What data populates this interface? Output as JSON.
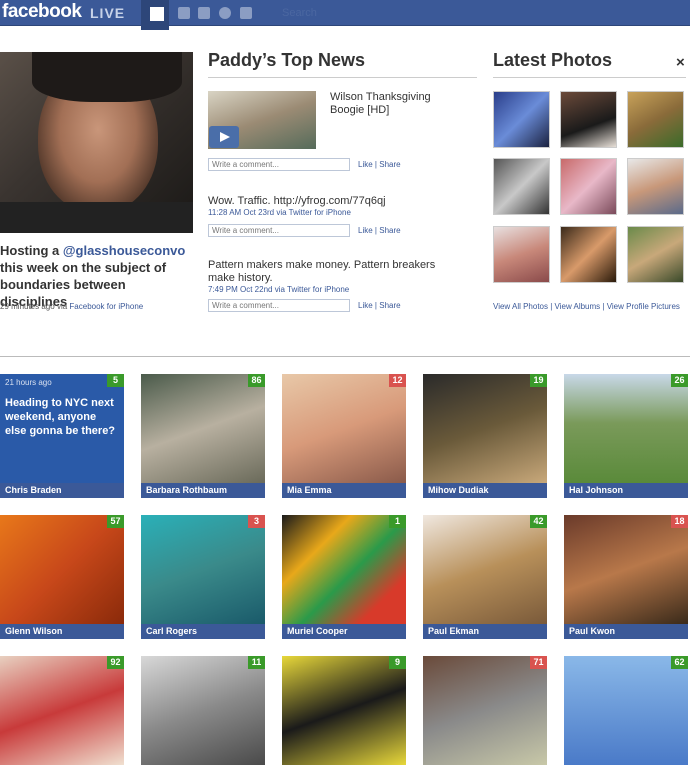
{
  "header": {
    "logo": "facebook",
    "live": "LIVE",
    "search_placeholder": "Search"
  },
  "featured": {
    "status_prefix": "Hosting a ",
    "status_link": "@glasshouseconvo",
    "status_rest": " this week on the subject of boundaries between disciplines",
    "time": "29 minutes ago",
    "via": "via",
    "source": "Facebook for iPhone"
  },
  "news": {
    "title": "Paddy’s Top News",
    "comment_placeholder": "Write a comment...",
    "like": "Like",
    "sep": "|",
    "share": "Share",
    "items": [
      {
        "text": "Wilson Thanksgiving Boogie [HD]",
        "meta": ""
      },
      {
        "text": "Wow. Traffic. http://yfrog.com/77q6qj",
        "meta": "11:28 AM Oct 23rd via Twitter for iPhone"
      },
      {
        "text": "Pattern makers make money. Pattern breakers make history.",
        "meta": "7:49 PM Oct 22nd via Twitter for iPhone"
      }
    ]
  },
  "photos": {
    "title": "Latest Photos",
    "close": "×",
    "links": "View All Photos | View Albums | View Profile Pictures"
  },
  "cards": [
    {
      "name": "Chris Braden",
      "count": "5",
      "badge": "green",
      "time": "21 hours ago",
      "text": "Heading to NYC next weekend, anyone else gonna be there?"
    },
    {
      "name": "Barbara Rothbaum",
      "count": "86",
      "badge": "green"
    },
    {
      "name": "Mia Emma",
      "count": "12",
      "badge": "red"
    },
    {
      "name": "Mihow Dudiak",
      "count": "19",
      "badge": "green"
    },
    {
      "name": "Hal Johnson",
      "count": "26",
      "badge": "green"
    },
    {
      "name": "Glenn Wilson",
      "count": "57",
      "badge": "green"
    },
    {
      "name": "Carl Rogers",
      "count": "3",
      "badge": "red"
    },
    {
      "name": "Muriel Cooper",
      "count": "1",
      "badge": "green"
    },
    {
      "name": "Paul Ekman",
      "count": "42",
      "badge": "green"
    },
    {
      "name": "Paul Kwon",
      "count": "18",
      "badge": "red"
    },
    {
      "name": "",
      "count": "92",
      "badge": "green"
    },
    {
      "name": "",
      "count": "11",
      "badge": "green"
    },
    {
      "name": "",
      "count": "9",
      "badge": "green"
    },
    {
      "name": "",
      "count": "71",
      "badge": "red"
    },
    {
      "name": "",
      "count": "62",
      "badge": "green"
    }
  ]
}
